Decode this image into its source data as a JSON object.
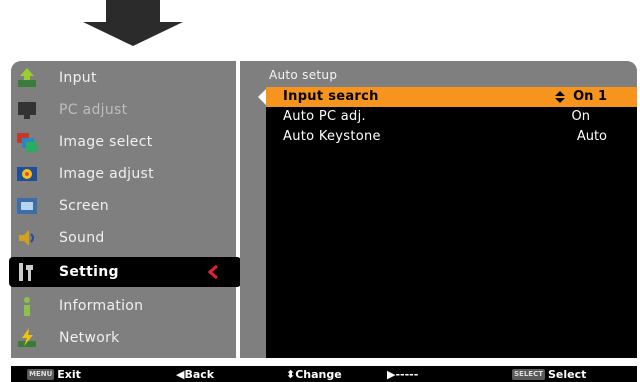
{
  "menu": {
    "items": [
      {
        "label": "Input",
        "icon": "input-icon"
      },
      {
        "label": "PC adjust",
        "icon": "pc-adjust-icon"
      },
      {
        "label": "Image select",
        "icon": "image-select-icon"
      },
      {
        "label": "Image adjust",
        "icon": "image-adjust-icon"
      },
      {
        "label": "Screen",
        "icon": "screen-icon"
      },
      {
        "label": "Sound",
        "icon": "sound-icon"
      },
      {
        "label": "Setting",
        "icon": "setting-icon"
      },
      {
        "label": "Information",
        "icon": "information-icon"
      },
      {
        "label": "Network",
        "icon": "network-icon"
      }
    ],
    "selected": "Setting"
  },
  "panel": {
    "title": "Auto setup",
    "rows": [
      {
        "label": "Input search",
        "value": "On 1"
      },
      {
        "label": "Auto PC adj.",
        "value": "On"
      },
      {
        "label": "Auto Keystone",
        "value": "Auto"
      }
    ]
  },
  "footer": {
    "exit_key": "MENU",
    "exit": "Exit",
    "back": "Back",
    "change": "Change",
    "next": "-----",
    "select_key": "SELECT",
    "select": "Select"
  },
  "colors": {
    "panel_bg": "#7f7f7f",
    "highlight": "#f7941d",
    "accent_red": "#e8202a"
  }
}
